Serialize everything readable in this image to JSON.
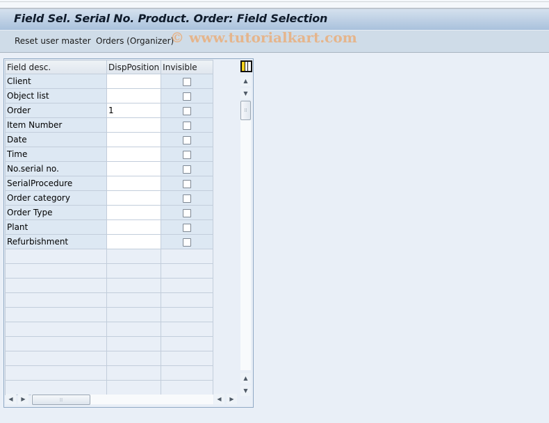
{
  "window": {
    "title": "Field Sel. Serial No. Product. Order: Field Selection"
  },
  "toolbar": {
    "buttons": [
      {
        "label": "Reset user master"
      },
      {
        "label": "Orders (Organizer)"
      }
    ],
    "watermark": "© www.tutorialkart.com"
  },
  "grid": {
    "columns": [
      "Field desc.",
      "DispPosition",
      "Invisible"
    ],
    "rows": [
      {
        "field_desc": "Client",
        "disp_position": "",
        "invisible": false
      },
      {
        "field_desc": "Object list",
        "disp_position": "",
        "invisible": false
      },
      {
        "field_desc": "Order",
        "disp_position": "1",
        "invisible": false
      },
      {
        "field_desc": "Item Number",
        "disp_position": "",
        "invisible": false
      },
      {
        "field_desc": "Date",
        "disp_position": "",
        "invisible": false
      },
      {
        "field_desc": "Time",
        "disp_position": "",
        "invisible": false
      },
      {
        "field_desc": "No.serial no.",
        "disp_position": "",
        "invisible": false
      },
      {
        "field_desc": "SerialProcedure",
        "disp_position": "",
        "invisible": false
      },
      {
        "field_desc": "Order category",
        "disp_position": "",
        "invisible": false
      },
      {
        "field_desc": "Order Type",
        "disp_position": "",
        "invisible": false
      },
      {
        "field_desc": "Plant",
        "disp_position": "",
        "invisible": false
      },
      {
        "field_desc": "Refurbishment",
        "disp_position": "",
        "invisible": false
      }
    ],
    "empty_row_count": 10,
    "icons": {
      "column_config": "column-settings-icon",
      "scroll_up": "▲",
      "scroll_down": "▼",
      "scroll_left": "◀",
      "scroll_right": "▶",
      "grip": "⁞⁞"
    }
  }
}
